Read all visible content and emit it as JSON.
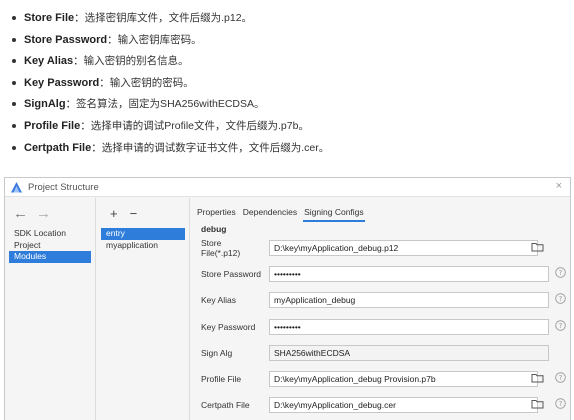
{
  "doc": {
    "items": [
      {
        "term": "Store File",
        "desc": "：选择密钥库文件，文件后缀为.p12。"
      },
      {
        "term": "Store Password",
        "desc": "：输入密钥库密码。"
      },
      {
        "term": "Key Alias",
        "desc": "：输入密钥的别名信息。"
      },
      {
        "term": "Key Password",
        "desc": "：输入密钥的密码。"
      },
      {
        "term": "SignAlg",
        "desc": "：签名算法，固定为SHA256withECDSA。"
      },
      {
        "term": "Profile File",
        "desc": "：选择申请的调试Profile文件，文件后缀为.p7b。"
      },
      {
        "term": "Certpath File",
        "desc": "：选择申请的调试数字证书文件，文件后缀为.cer。"
      }
    ]
  },
  "dialog": {
    "title": "Project Structure",
    "close": "×",
    "icons": {
      "app": "project-structure-icon",
      "folder": "folder-icon",
      "help": "help-icon",
      "close": "close-icon"
    },
    "colors": {
      "selection": "#2f7ddb",
      "background": "#f5f5f5"
    },
    "nav": {
      "back": "←",
      "forward": "→"
    },
    "left_items": [
      "SDK Location",
      "Project",
      "Modules"
    ],
    "left_selected": "Modules",
    "mid_tools": {
      "add": "+",
      "remove": "−"
    },
    "mid_items": [
      "entry",
      "myapplication"
    ],
    "mid_selected": "entry",
    "tabs": [
      "Properties",
      "Dependencies",
      "Signing Configs"
    ],
    "active_tab": "Signing Configs",
    "section": "debug",
    "fields": {
      "store_file": {
        "label": "Store File(*.p12)",
        "value": "D:\\key\\myApplication_debug.p12"
      },
      "store_password": {
        "label": "Store Password",
        "value": "•••••••••"
      },
      "key_alias": {
        "label": "Key Alias",
        "value": "myApplication_debug"
      },
      "key_password": {
        "label": "Key Password",
        "value": "•••••••••"
      },
      "sign_alg": {
        "label": "Sign Alg",
        "value": "SHA256withECDSA"
      },
      "profile_file": {
        "label": "Profile File",
        "value": "D:\\key\\myApplication_debug Provision.p7b"
      },
      "certpath_file": {
        "label": "Certpath File",
        "value": "D:\\key\\myApplication_debug.cer"
      }
    }
  }
}
